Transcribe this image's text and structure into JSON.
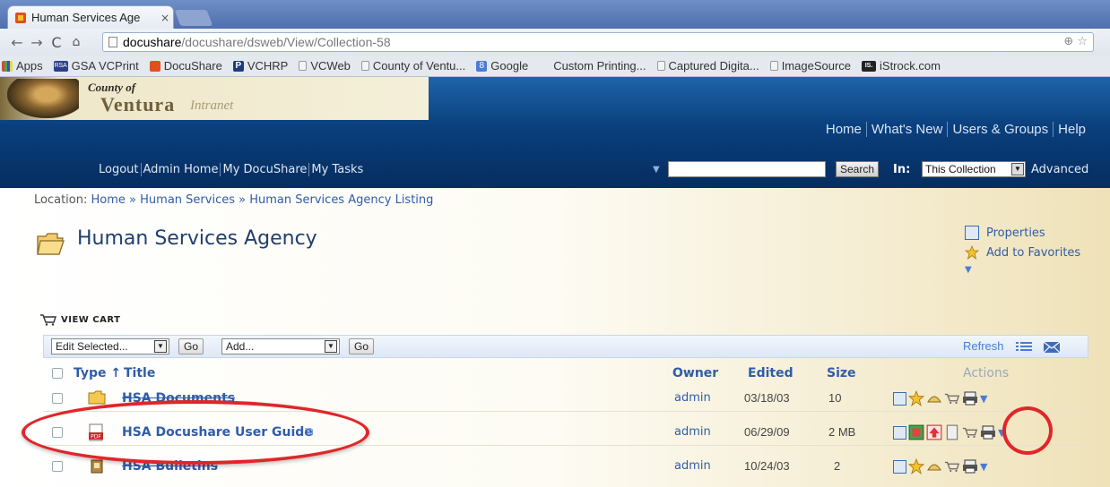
{
  "browser": {
    "tab_title": "Human Services Age",
    "tab_close": "×",
    "url_host": "docushare",
    "url_path": "/docushare/dsweb/View/Collection-58",
    "omni_right": "⊕ ☆"
  },
  "bookmarks": [
    {
      "icon": "apps-icon",
      "label": "Apps"
    },
    {
      "icon": "gsa-icon",
      "label": "GSA VCPrint"
    },
    {
      "icon": "docushare-icon",
      "label": "DocuShare"
    },
    {
      "icon": "vchrp-icon",
      "label": "VCHRP"
    },
    {
      "icon": "page-icon",
      "label": "VCWeb"
    },
    {
      "icon": "page-icon",
      "label": "County of Ventu..."
    },
    {
      "icon": "google-icon",
      "label": "Google"
    },
    {
      "icon": "none",
      "label": "Custom Printing..."
    },
    {
      "icon": "page-icon",
      "label": "Captured Digita..."
    },
    {
      "icon": "page-icon",
      "label": "ImageSource"
    },
    {
      "icon": "istrock-icon",
      "label": "iStrock.com"
    }
  ],
  "header": {
    "logo_county": "County of",
    "logo_ventura": "Ventura",
    "logo_intranet": "Intranet",
    "topnav": [
      "Home",
      "What's New",
      "Users & Groups",
      "Help"
    ],
    "subnav": [
      "Logout",
      "Admin Home",
      "My DocuShare",
      "My Tasks"
    ],
    "search_button": "Search",
    "in_label": "In:",
    "scope_value": "This Collection",
    "advanced": "Advanced"
  },
  "content": {
    "breadcrumb_prefix": "Location:",
    "breadcrumb": [
      "Home",
      "Human Services",
      "Human Services Agency Listing"
    ],
    "breadcrumb_sep": "»",
    "page_title": "Human Services Agency",
    "side_actions": [
      "Properties",
      "Add to Favorites"
    ],
    "view_cart": "VIEW CART",
    "edit_selected": "Edit Selected...",
    "add_select": "Add...",
    "go": "Go",
    "refresh": "Refresh",
    "columns": {
      "type": "Type ↑",
      "title": "Title",
      "owner": "Owner",
      "edited": "Edited",
      "size": "Size",
      "actions": "Actions"
    },
    "rows": [
      {
        "type": "folder",
        "title": "HSA Documents",
        "owner": "admin",
        "edited": "03/18/03",
        "size": "10"
      },
      {
        "type": "pdf",
        "title": "HSA Docushare User Guide",
        "owner": "admin",
        "edited": "06/29/09",
        "size": "2 MB"
      },
      {
        "type": "bulletin",
        "title": "HSA Bulletins",
        "owner": "admin",
        "edited": "10/24/03",
        "size": "2"
      }
    ]
  },
  "colors": {
    "accent": "#2f5da8",
    "highlight": "#e0262a",
    "header": "#0a3f7d"
  }
}
